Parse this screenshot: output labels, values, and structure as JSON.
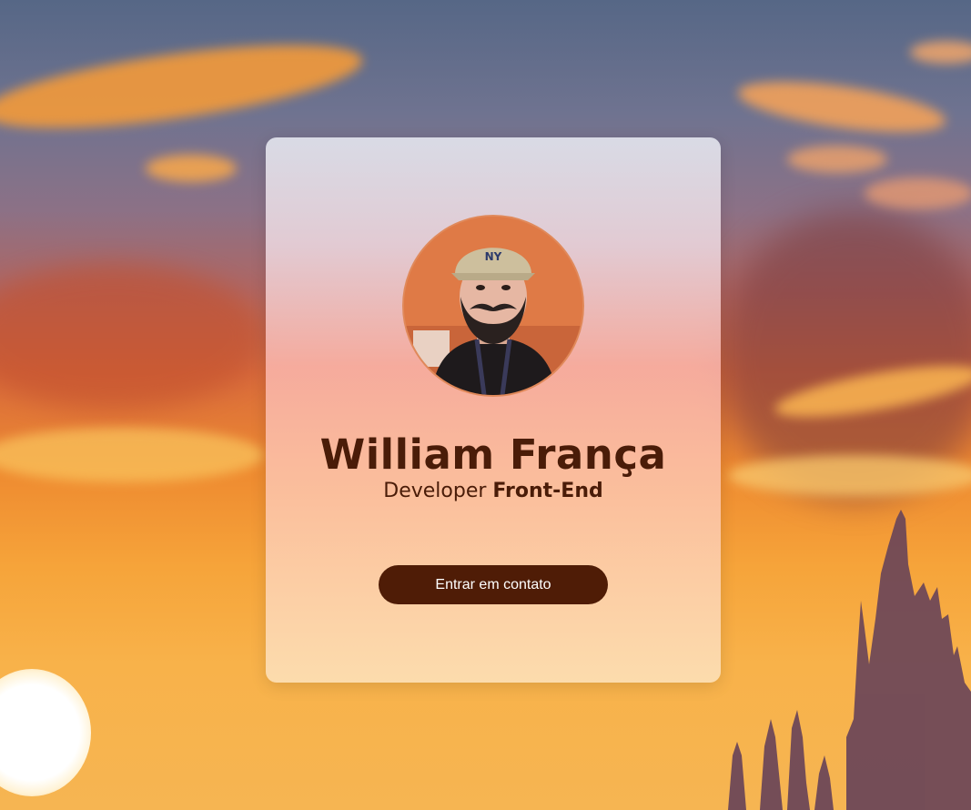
{
  "profile": {
    "name": "William França",
    "role_prefix": "Developer",
    "role_highlight": "Front-End",
    "contact_button": "Entrar em contato"
  },
  "colors": {
    "accent": "#4f1c06",
    "text": "#4a1c08",
    "avatar_ring": "#e0895a"
  },
  "icons": {
    "avatar": "profile-photo"
  }
}
